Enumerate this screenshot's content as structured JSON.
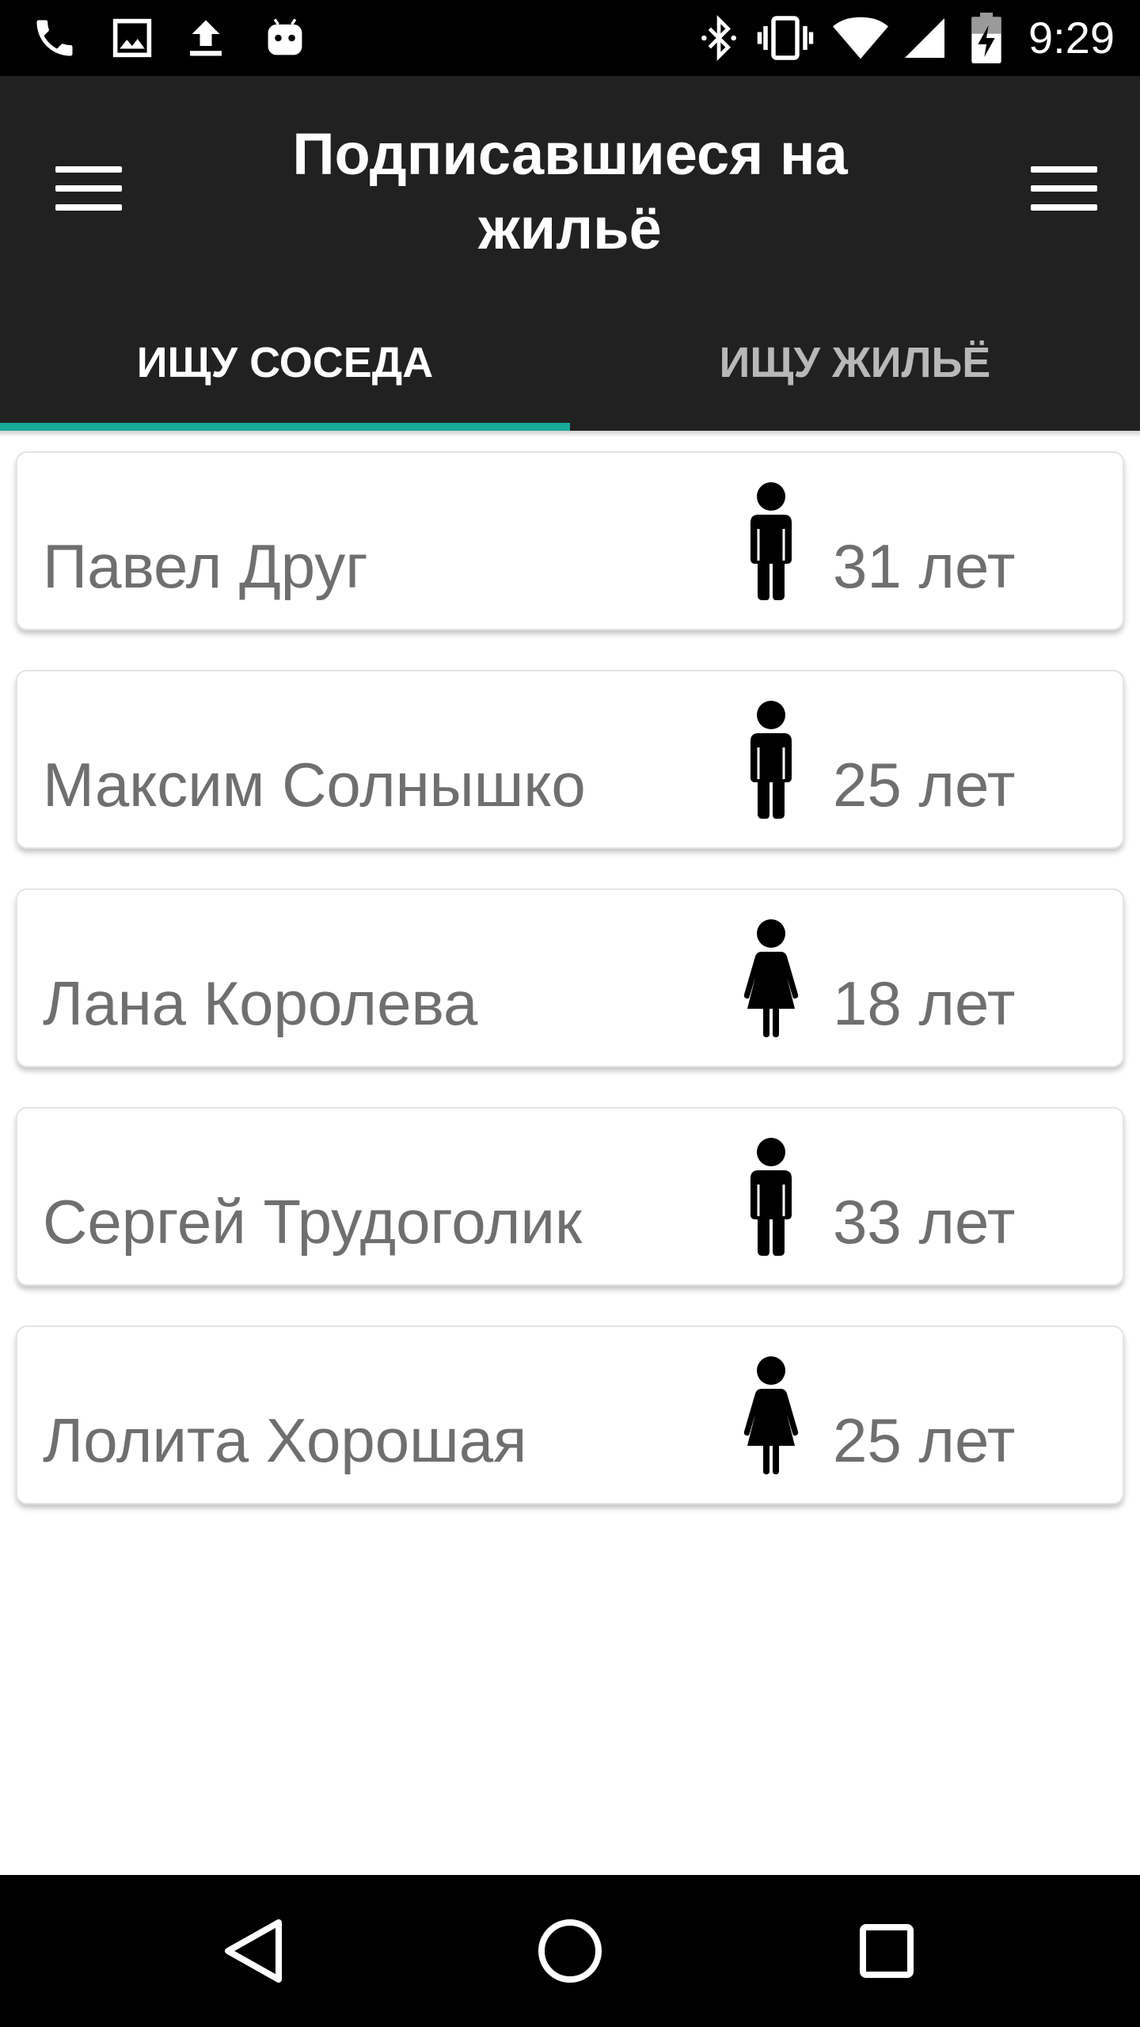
{
  "status_bar": {
    "time": "9:29",
    "left_icons": [
      "phone-icon",
      "image-icon",
      "upload-icon",
      "android-icon"
    ],
    "right_icons": [
      "bluetooth-icon",
      "vibrate-icon",
      "wifi-icon",
      "signal-icon",
      "battery-charging-icon"
    ]
  },
  "app_bar": {
    "title": "Подписавшиеся на жильё",
    "left_menu_icon": "menu-icon",
    "right_menu_icon": "menu-icon"
  },
  "tabs": [
    {
      "label": "ИЩУ СОСЕДА",
      "active": true
    },
    {
      "label": "ИЩУ ЖИЛЬЁ",
      "active": false
    }
  ],
  "colors": {
    "app_bar_bg": "#212121",
    "tab_indicator": "#18a999",
    "text_grey": "#6f6f6f"
  },
  "people": [
    {
      "name": "Павел Друг",
      "gender_icon": "male-icon",
      "age": "31 лет"
    },
    {
      "name": "Максим Солнышко",
      "gender_icon": "male-icon",
      "age": "25 лет"
    },
    {
      "name": "Лана Королева",
      "gender_icon": "female-icon",
      "age": "18 лет"
    },
    {
      "name": "Сергей Трудоголик",
      "gender_icon": "male-icon",
      "age": "33 лет"
    },
    {
      "name": "Лолита Хорошая",
      "gender_icon": "female-icon",
      "age": "25 лет"
    }
  ],
  "nav_bar": {
    "buttons": [
      "back-icon",
      "home-icon",
      "recents-icon"
    ]
  }
}
